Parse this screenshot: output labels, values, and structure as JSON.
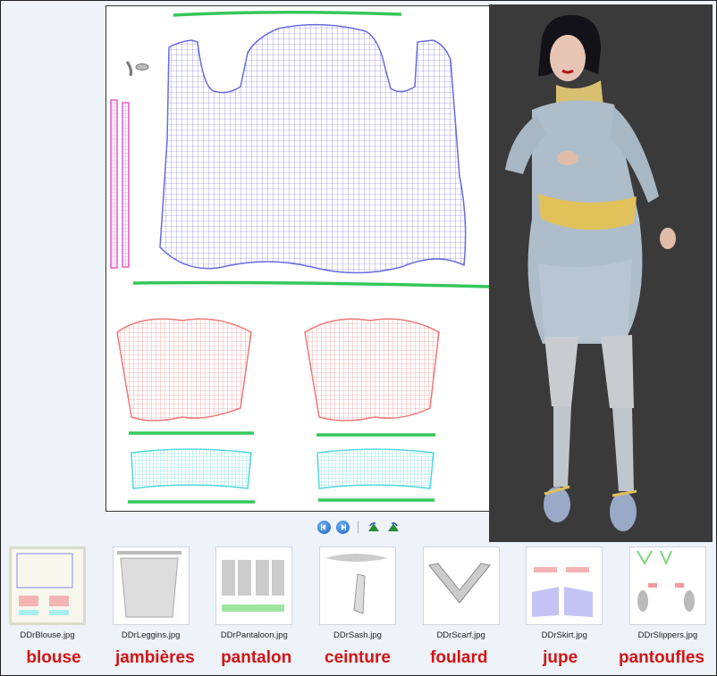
{
  "viewer": {
    "nav": {
      "prev_icon": "previous-icon",
      "next_icon": "next-icon",
      "rotate_left_icon": "rotate-left-icon",
      "rotate_right_icon": "rotate-right-icon"
    },
    "colors": {
      "blouse_mesh": "#6a6ae0",
      "sleeve_mesh": "#e060c8",
      "green_strip": "#34c759",
      "red_mesh": "#ee7a7a",
      "cyan_mesh": "#55d8dc"
    }
  },
  "thumbnails": [
    {
      "file": "DDrBlouse.jpg",
      "label": "blouse",
      "selected": true
    },
    {
      "file": "DDrLeggins.jpg",
      "label": "jambières",
      "selected": false
    },
    {
      "file": "DDrPantaloon.jpg",
      "label": "pantalon",
      "selected": false
    },
    {
      "file": "DDrSash.jpg",
      "label": "ceinture",
      "selected": false
    },
    {
      "file": "DDrScarf.jpg",
      "label": "foulard",
      "selected": false
    },
    {
      "file": "DDrSkirt.jpg",
      "label": "jupe",
      "selected": false
    },
    {
      "file": "DDrSlippers.jpg",
      "label": "pantoufles",
      "selected": false
    }
  ]
}
